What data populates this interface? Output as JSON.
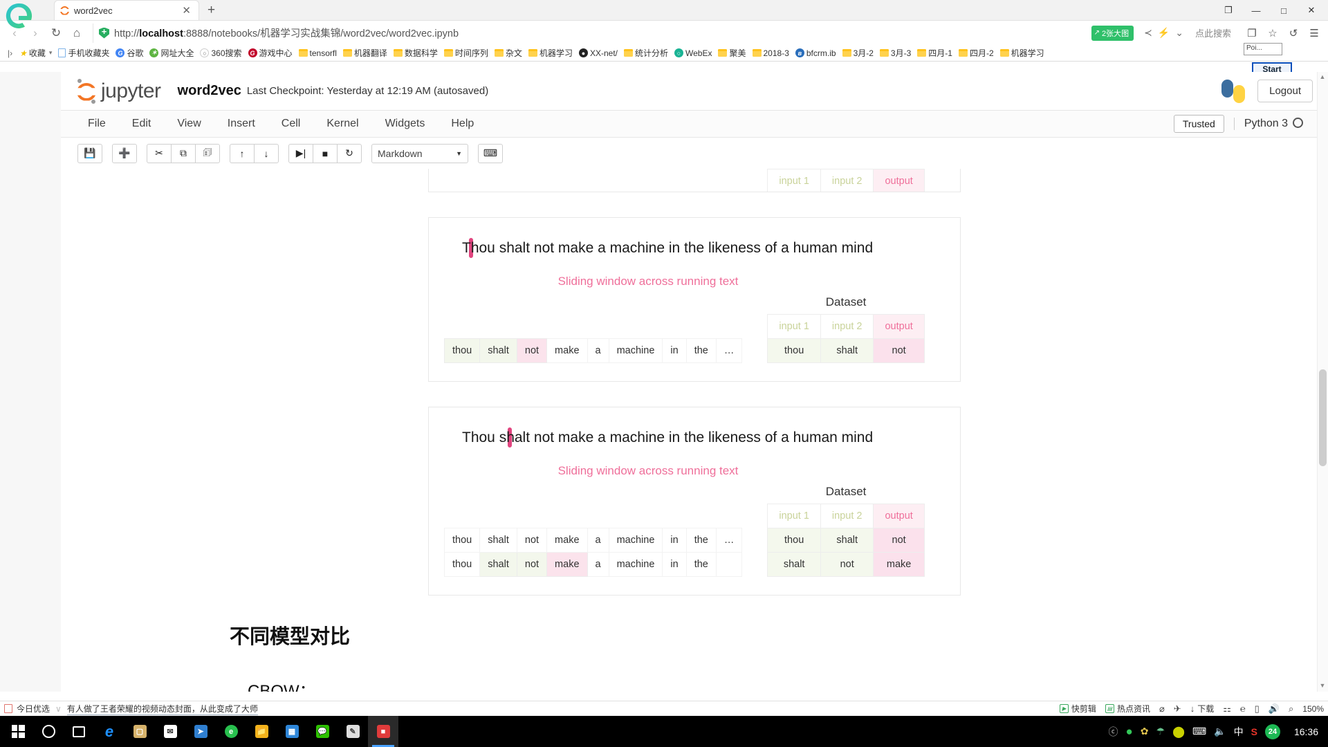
{
  "browser": {
    "tab": {
      "title": "word2vec",
      "close_label": "✕"
    },
    "newtab_label": "+",
    "window_buttons": {
      "restore": "❐",
      "minimize": "—",
      "maximize": "□",
      "close": "✕"
    },
    "nav": {
      "back": "‹",
      "forward": "›",
      "reload": "↻",
      "home": "⌂"
    },
    "url": {
      "scheme": "http://",
      "host": "localhost",
      "rest": ":8888/notebooks/机器学习实战集锦/word2vec/word2vec.ipynb",
      "full": "http://localhost:8888/notebooks/机器学习实战集锦/word2vec/word2vec.ipynb"
    },
    "badge": {
      "text": "2张大图",
      "icon": "↗"
    },
    "url_icons": {
      "share": "≺",
      "lightning": "⚡",
      "chevron": "⌄"
    },
    "search_placeholder": "点此搜索",
    "toolbar_icons": {
      "collections": "❐",
      "favorites": "☆",
      "history": "↺",
      "menu": "☰"
    },
    "poi_label": "Poi...",
    "start_label": "Start",
    "bookmarks_lead": "|›",
    "bookmarks": [
      {
        "label": "收藏",
        "type": "star",
        "caret": true
      },
      {
        "label": "手机收藏夹",
        "type": "page"
      },
      {
        "label": "谷歌",
        "type": "dot",
        "color": "#4285f4",
        "glyph": "G"
      },
      {
        "label": "网址大全",
        "type": "dot",
        "color": "#5db441",
        "glyph": "✶"
      },
      {
        "label": "360搜索",
        "type": "dot",
        "color": "#ffffff",
        "glyph": "○"
      },
      {
        "label": "游戏中心",
        "type": "dot",
        "color": "#c1002a",
        "glyph": "G"
      },
      {
        "label": "tensorfl",
        "type": "folder"
      },
      {
        "label": "机器翻译",
        "type": "folder"
      },
      {
        "label": "数据科学",
        "type": "folder"
      },
      {
        "label": "时间序列",
        "type": "folder"
      },
      {
        "label": "杂文",
        "type": "folder"
      },
      {
        "label": "机器学习",
        "type": "folder"
      },
      {
        "label": "XX-net/",
        "type": "dot",
        "color": "#222222",
        "glyph": "●"
      },
      {
        "label": "统计分析",
        "type": "folder"
      },
      {
        "label": "WebEx",
        "type": "dot",
        "color": "#19b394",
        "glyph": "○"
      },
      {
        "label": "聚美",
        "type": "folder"
      },
      {
        "label": "2018-3",
        "type": "folder"
      },
      {
        "label": "bfcrm.ib",
        "type": "dot",
        "color": "#2a6ebb",
        "glyph": "ʙ"
      },
      {
        "label": "3月-2",
        "type": "folder"
      },
      {
        "label": "3月-3",
        "type": "folder"
      },
      {
        "label": "四月-1",
        "type": "folder"
      },
      {
        "label": "四月-2",
        "type": "folder"
      },
      {
        "label": "机器学习",
        "type": "folder"
      }
    ],
    "bookmarks_right_icons": [
      "★",
      "⬇",
      "▣",
      "⌖",
      "⋮",
      "⊞"
    ]
  },
  "jupyter": {
    "brand": "jupyter",
    "notebook_name": "word2vec",
    "checkpoint": "Last Checkpoint: Yesterday at 12:19 AM (autosaved)",
    "logout_label": "Logout",
    "menu": [
      "File",
      "Edit",
      "View",
      "Insert",
      "Cell",
      "Kernel",
      "Widgets",
      "Help"
    ],
    "trusted_label": "Trusted",
    "kernel_label": "Python 3",
    "toolbar": {
      "groups": [
        [
          {
            "name": "save-button",
            "glyph": "💾"
          }
        ],
        [
          {
            "name": "insert-cell-below-button",
            "glyph": "➕"
          }
        ],
        [
          {
            "name": "cut-cell-button",
            "glyph": "✂"
          },
          {
            "name": "copy-cell-button",
            "glyph": "⧉"
          },
          {
            "name": "paste-cell-button",
            "glyph": "🗊"
          }
        ],
        [
          {
            "name": "move-cell-up-button",
            "glyph": "↑"
          },
          {
            "name": "move-cell-down-button",
            "glyph": "↓"
          }
        ],
        [
          {
            "name": "run-cell-button",
            "glyph": "▶|"
          },
          {
            "name": "interrupt-kernel-button",
            "glyph": "■"
          },
          {
            "name": "restart-kernel-button",
            "glyph": "↻"
          }
        ]
      ],
      "cell_type": "Markdown",
      "cell_type_caret": "▼",
      "command_palette_glyph": "⌨"
    }
  },
  "notebook": {
    "words_header": [
      "thou",
      "shalt",
      "not",
      "make",
      "a",
      "machine",
      "in",
      "the",
      "…"
    ],
    "dataset_title": "Dataset",
    "dataset_headers": [
      "input 1",
      "input 2",
      "output"
    ],
    "sliding_caption": "Sliding window across running text",
    "block1": {
      "word_row": [
        "thou",
        "shalt",
        "not",
        "make",
        "a",
        "machine",
        "in",
        "the",
        "…"
      ],
      "highlight_index": 2,
      "green_indices": [
        0,
        1
      ]
    },
    "block2": {
      "sentence_pre": "",
      "sentence_highlight": "Thou shalt not",
      "sentence_post": " make a machine in the likeness of a human mind",
      "full_sentence": "Thou shalt not make a machine in the likeness of a human mind",
      "word_row": [
        "thou",
        "shalt",
        "not",
        "make",
        "a",
        "machine",
        "in",
        "the",
        "…"
      ],
      "green_indices": [
        0,
        1
      ],
      "pink_indices": [
        2
      ],
      "dataset_rows": [
        [
          "thou",
          "shalt",
          "not"
        ]
      ]
    },
    "block3": {
      "sentence_pre": "Thou ",
      "sentence_highlight": "shalt not make",
      "sentence_post": " a machine in the likeness of a human mind",
      "full_sentence": "Thou shalt not make a machine in the likeness of a human mind",
      "word_row_1": [
        "thou",
        "shalt",
        "not",
        "make",
        "a",
        "machine",
        "in",
        "the",
        "…"
      ],
      "row1_green_indices": [],
      "row1_pink_indices": [],
      "word_row_2": [
        "thou",
        "shalt",
        "not",
        "make",
        "a",
        "machine",
        "in",
        "the",
        ""
      ],
      "row2_green_indices": [
        1,
        2
      ],
      "row2_pink_indices": [
        3
      ],
      "dataset_rows": [
        [
          "thou",
          "shalt",
          "not"
        ],
        [
          "shalt",
          "not",
          "make"
        ]
      ]
    },
    "heading_cn": "不同模型对比",
    "heading_cbow": "CBOW："
  },
  "adbar": {
    "left_label": "今日优选",
    "divider": "∨",
    "news": "有人做了王者荣耀的视频动态封面，从此变成了大师",
    "items": [
      {
        "label": "快剪辑",
        "glyph": "▶"
      },
      {
        "label": "热点资讯",
        "glyph": "▤"
      }
    ],
    "icons": [
      "⌀",
      "✈",
      "↓ 下载",
      "⚑",
      "℮",
      "❐",
      "⧉",
      "□"
    ],
    "download_label": "下载",
    "volume_glyph": "🔊",
    "search_glyph": "⌕",
    "zoom_level": "150%"
  },
  "taskbar": {
    "items": [
      {
        "name": "start-button",
        "icon": "windows"
      },
      {
        "name": "cortana-button",
        "icon": "circle"
      },
      {
        "name": "task-view-button",
        "icon": "taskview"
      },
      {
        "name": "edge-button",
        "icon": "edge"
      },
      {
        "name": "store-button",
        "icon": "store",
        "color": "#d6b26b"
      },
      {
        "name": "mail-button",
        "icon": "mail",
        "color": "#ffffff"
      },
      {
        "name": "bird-app-button",
        "icon": "bird",
        "color": "#2f7fd0"
      },
      {
        "name": "browser-360-button",
        "icon": "green-circle",
        "color": "#28c04e"
      },
      {
        "name": "explorer-button",
        "icon": "folder",
        "color": "#f3b21b"
      },
      {
        "name": "office-button",
        "icon": "office",
        "color": "#2e86d8"
      },
      {
        "name": "wechat-button",
        "icon": "wechat",
        "color": "#2dc100"
      },
      {
        "name": "paint-button",
        "icon": "paint",
        "color": "#cfcfcf"
      },
      {
        "name": "notebook-app-button",
        "icon": "red-app",
        "color": "#e03b3b",
        "active": true
      }
    ],
    "tray": [
      {
        "name": "onenote-tray-icon",
        "glyph": "Ⓝ",
        "color": "#b8b8b8"
      },
      {
        "name": "browser-tray-icon",
        "glyph": "●",
        "color": "#34c759"
      },
      {
        "name": "pinyin-tray-icon",
        "glyph": "✿",
        "color": "#e7c84f"
      },
      {
        "name": "security-tray-icon",
        "glyph": "☢",
        "color": "#66c18c"
      },
      {
        "name": "update-tray-icon",
        "glyph": "⬤",
        "color": "#c9d100"
      },
      {
        "name": "network-tray-icon",
        "glyph": "⌨",
        "color": "#ffffff"
      },
      {
        "name": "volume-tray-icon",
        "glyph": "🔊",
        "color": "#ffffff"
      },
      {
        "name": "ime-tray-icon",
        "glyph": "中",
        "color": "#ffffff"
      },
      {
        "name": "sogou-tray-icon",
        "glyph": "S",
        "color": "#e8342a"
      },
      {
        "name": "counter-tray-icon",
        "glyph": "24",
        "color": "#1db954"
      }
    ],
    "clock": "16:36"
  }
}
